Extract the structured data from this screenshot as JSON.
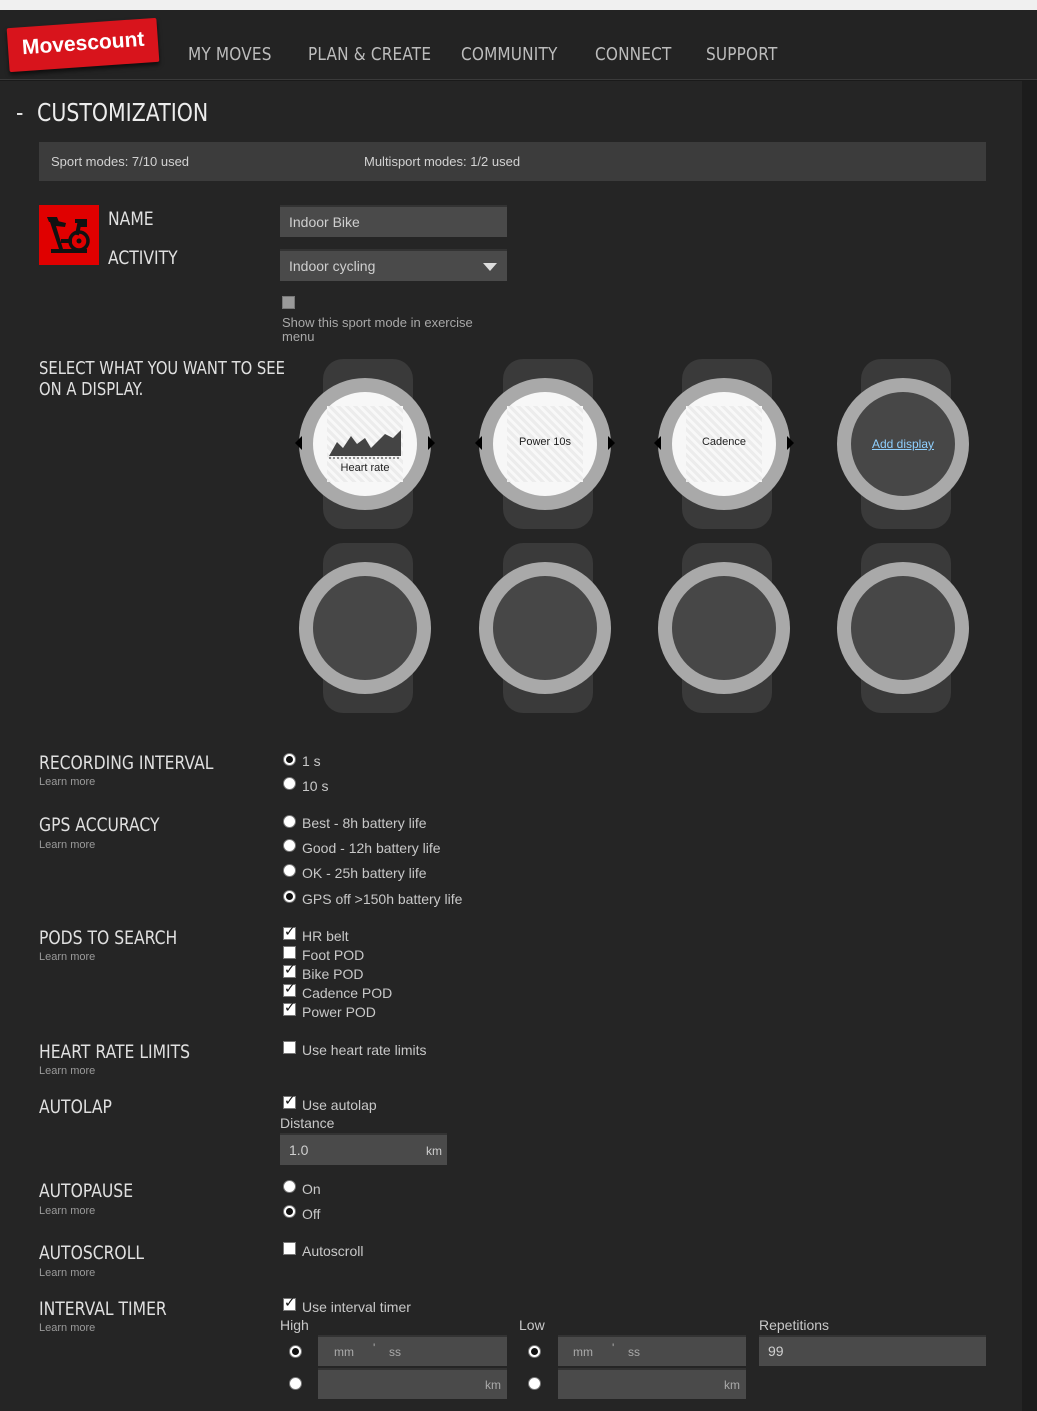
{
  "nav": {
    "logo": "Movescount",
    "items": [
      "MY MOVES",
      "PLAN & CREATE",
      "COMMUNITY",
      "CONNECT",
      "SUPPORT"
    ]
  },
  "page": {
    "collapse_glyph": "-",
    "title": "CUSTOMIZATION"
  },
  "status": {
    "sport_modes": "Sport modes: 7/10 used",
    "multisport_modes": "Multisport modes: 1/2 used"
  },
  "sport": {
    "icon": "indoor-bike-icon",
    "name_label": "NAME",
    "activity_label": "ACTIVITY",
    "name_value": "Indoor Bike",
    "activity_value": "Indoor cycling",
    "show_in_menu_label_1": "Show this sport mode in exercise",
    "show_in_menu_label_2": "menu",
    "show_in_menu": false
  },
  "displays": {
    "heading_1": "SELECT WHAT YOU WANT TO SEE",
    "heading_2": "ON A DISPLAY.",
    "items": [
      "Heart rate",
      "Power 10s",
      "Cadence"
    ],
    "add_label": "Add display"
  },
  "recording": {
    "heading": "RECORDING INTERVAL",
    "learn": "Learn more",
    "options": [
      "1 s",
      "10 s"
    ],
    "selected": 0
  },
  "gps": {
    "heading": "GPS ACCURACY",
    "learn": "Learn more",
    "options": [
      "Best - 8h battery life",
      "Good - 12h battery life",
      "OK - 25h battery life",
      "GPS off >150h battery life"
    ],
    "selected": 3
  },
  "pods": {
    "heading": "PODS TO SEARCH",
    "learn": "Learn more",
    "items": [
      {
        "label": "HR belt",
        "checked": true
      },
      {
        "label": "Foot POD",
        "checked": false
      },
      {
        "label": "Bike POD",
        "checked": true
      },
      {
        "label": "Cadence POD",
        "checked": true
      },
      {
        "label": "Power POD",
        "checked": true
      }
    ]
  },
  "hr_limits": {
    "heading": "HEART RATE LIMITS",
    "learn": "Learn more",
    "label": "Use heart rate limits",
    "checked": false
  },
  "autolap": {
    "heading": "AUTOLAP",
    "label": "Use autolap",
    "checked": true,
    "distance_label": "Distance",
    "distance_value": "1.0",
    "unit": "km"
  },
  "autopause": {
    "heading": "AUTOPAUSE",
    "learn": "Learn more",
    "options": [
      "On",
      "Off"
    ],
    "selected": 1
  },
  "autoscroll": {
    "heading": "AUTOSCROLL",
    "learn": "Learn more",
    "label": "Autoscroll",
    "checked": false
  },
  "interval": {
    "heading": "INTERVAL TIMER",
    "learn": "Learn more",
    "label": "Use interval timer",
    "checked": true,
    "high_label": "High",
    "low_label": "Low",
    "reps_label": "Repetitions",
    "reps_value": "99",
    "mm": "mm",
    "sep": "'",
    "ss": "ss",
    "km": "km"
  }
}
